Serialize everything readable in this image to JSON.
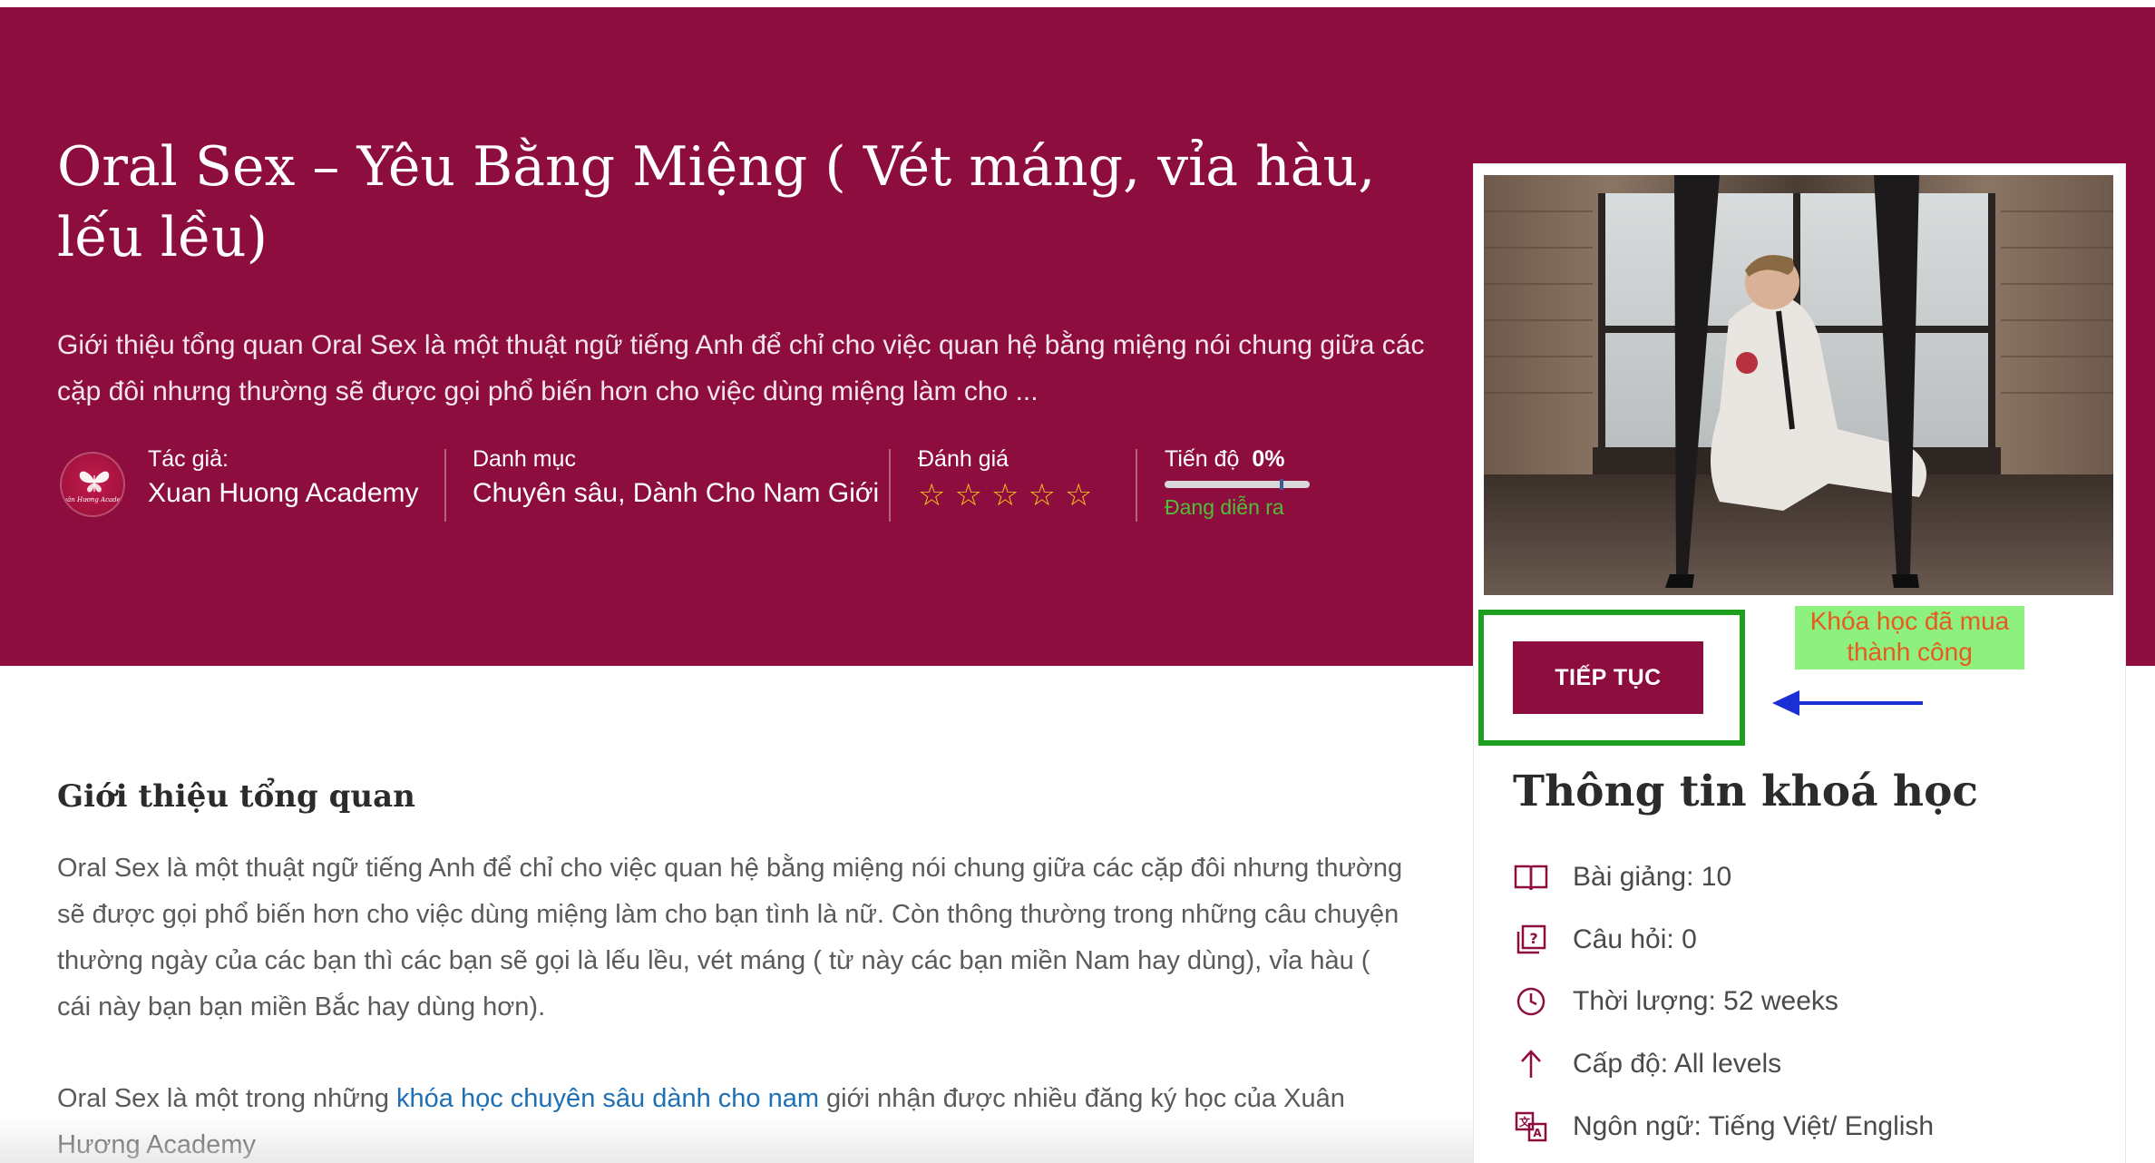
{
  "hero": {
    "title": "Oral Sex – Yêu Bằng Miệng ( Vét máng, vỉa hàu, lếu lều)",
    "description": "Giới thiệu tổng quan Oral Sex là một thuật ngữ tiếng Anh để chỉ cho việc quan hệ bằng miệng nói chung giữa các cặp đôi nhưng thường sẽ được gọi phổ biến hơn cho việc dùng miệng làm cho ...",
    "background_color": "#8e0d3f"
  },
  "meta": {
    "author_label": "Tác giả:",
    "author_name": "Xuan Huong Academy",
    "avatar_logo_text": "Xuân Hương Academy",
    "category_label": "Danh mục",
    "category_value": "Chuyên sâu, Dành Cho Nam Giới",
    "rating_label": "Đánh giá",
    "rating_value": 0,
    "rating_max": 5,
    "star_glyph": "☆",
    "progress_label": "Tiến độ",
    "progress_value": "0%",
    "progress_status": "Đang diễn ra"
  },
  "content": {
    "section_title": "Giới thiệu tổng quan",
    "paragraph1": "Oral Sex là một thuật ngữ tiếng Anh để chỉ cho việc quan hệ bằng miệng nói chung giữa các cặp đôi nhưng thường sẽ được gọi phổ biến hơn cho việc dùng miệng làm cho bạn tình là nữ. Còn thông thường trong những câu chuyện thường ngày của các bạn thì các bạn sẽ gọi là lếu lều, vét máng ( từ này các bạn miền Nam hay dùng), vỉa hàu ( cái này bạn bạn miền Bắc hay dùng hơn).",
    "paragraph2_before": "Oral Sex là một trong những ",
    "paragraph2_link": "khóa học chuyên sâu dành cho nam",
    "paragraph2_after": " giới nhận được nhiều đăng ký học của Xuân Hương Academy"
  },
  "sidebar": {
    "continue_button": "TIẾP TỤC",
    "purchase_note": "Khóa học đã mua thành công",
    "info_title": "Thông tin khoá học",
    "items": [
      {
        "icon": "book-icon",
        "text": "Bài giảng: 10"
      },
      {
        "icon": "quiz-icon",
        "text": "Câu hỏi: 0"
      },
      {
        "icon": "clock-icon",
        "text": "Thời lượng: 52 weeks"
      },
      {
        "icon": "level-icon",
        "text": "Cấp độ: All levels"
      },
      {
        "icon": "language-icon",
        "text": "Ngôn ngữ: Tiếng Việt/ English"
      }
    ]
  },
  "colors": {
    "brand": "#8e0d3f",
    "star": "#f5c518",
    "status_green": "#4fbf3a",
    "highlight_box": "#1da01d",
    "note_bg": "#8ef07e",
    "note_text": "#e85a1f",
    "arrow": "#1a2fd6",
    "link": "#1f6fb5"
  }
}
